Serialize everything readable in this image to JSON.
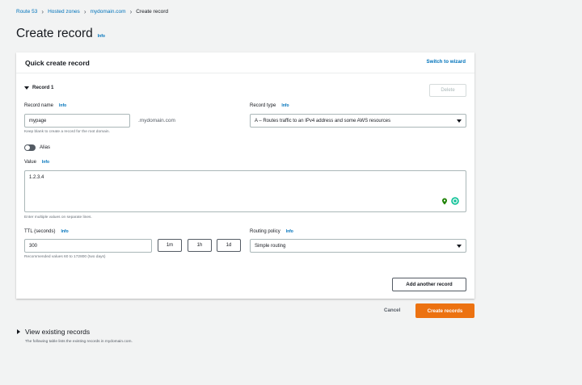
{
  "breadcrumb": {
    "items": [
      "Route 53",
      "Hosted zones",
      "mydomain.com"
    ],
    "current": "Create record",
    "separator": "›"
  },
  "page": {
    "title": "Create record",
    "info": "Info"
  },
  "panel": {
    "title": "Quick create record",
    "switch_label": "Switch to wizard"
  },
  "record": {
    "heading": "Record 1",
    "delete_label": "Delete",
    "name_label": "Record name",
    "name_info": "Info",
    "name_value": "mypage",
    "name_suffix": ".mydomain.com",
    "name_hint": "Keep blank to create a record for the root domain.",
    "type_label": "Record type",
    "type_info": "Info",
    "type_value": "A – Routes traffic to an IPv4 address and some AWS resources",
    "alias_label": "Alias",
    "value_label": "Value",
    "value_info": "Info",
    "value_text": "1.2.3.4",
    "value_hint": "Enter multiple values on separate lines.",
    "ttl_label": "TTL (seconds)",
    "ttl_info": "Info",
    "ttl_value": "300",
    "ttl_buttons": [
      "1m",
      "1h",
      "1d"
    ],
    "ttl_hint": "Recommended values 60 to 172800 (two days)",
    "routing_label": "Routing policy",
    "routing_info": "Info",
    "routing_value": "Simple routing",
    "add_another_label": "Add another record"
  },
  "actions": {
    "cancel_label": "Cancel",
    "create_label": "Create records"
  },
  "existing": {
    "title": "View existing records",
    "description": "The following table lists the existing records in mydomain.com."
  },
  "colors": {
    "link": "#0073bb",
    "primary": "#ec7211",
    "background": "#f2f3f3"
  },
  "icons": {
    "expand": "caret-down-icon",
    "collapse": "caret-right-icon",
    "dropdown": "caret-down-icon",
    "location": "location-pin-icon",
    "grammar": "grammarly-icon"
  }
}
